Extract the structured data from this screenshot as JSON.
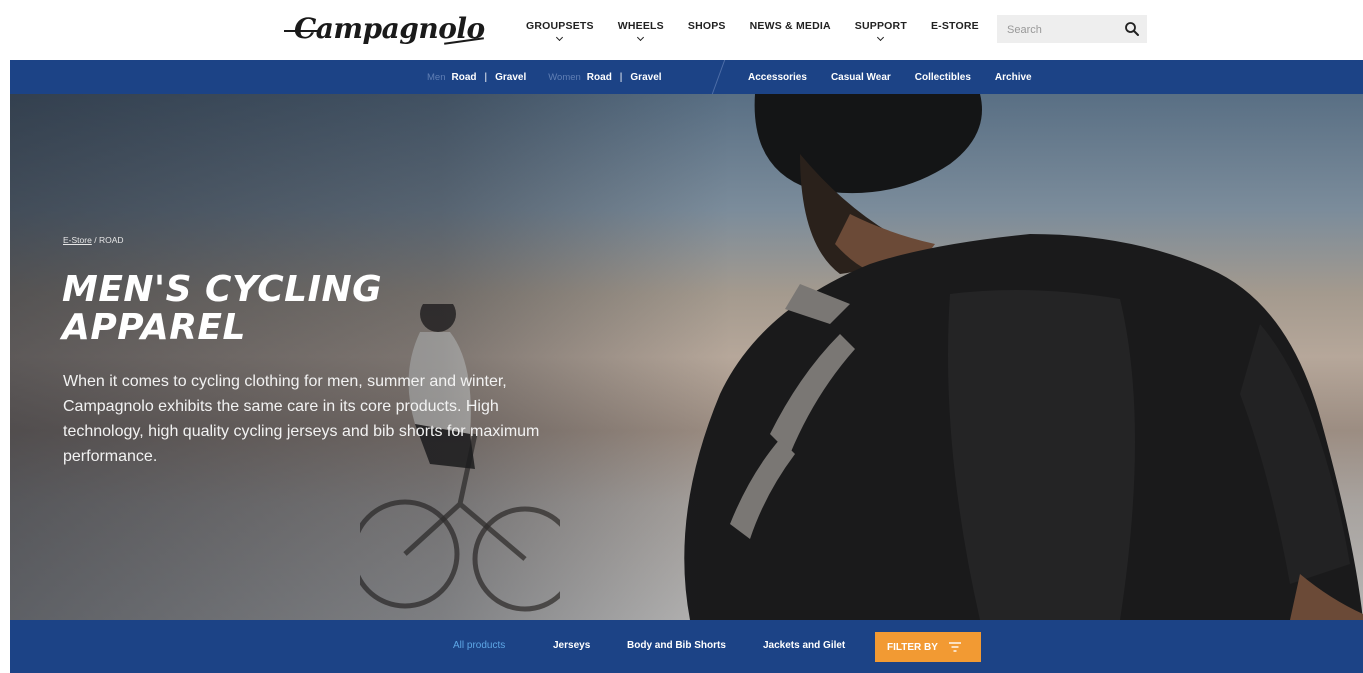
{
  "header": {
    "logo_text": "Campagnolo",
    "nav": [
      {
        "label": "GROUPSETS",
        "dropdown": true
      },
      {
        "label": "WHEELS",
        "dropdown": true
      },
      {
        "label": "SHOPS",
        "dropdown": false
      },
      {
        "label": "NEWS & MEDIA",
        "dropdown": false
      },
      {
        "label": "SUPPORT",
        "dropdown": true
      },
      {
        "label": "E-STORE",
        "dropdown": false
      }
    ],
    "search_placeholder": "Search",
    "search_icon": "search-icon"
  },
  "subnav": {
    "men_label": "Men",
    "men_links": [
      "Road",
      "Gravel"
    ],
    "women_label": "Women",
    "women_links": [
      "Road",
      "Gravel"
    ],
    "separator": "|",
    "right_links": [
      "Accessories",
      "Casual Wear",
      "Collectibles",
      "Archive"
    ]
  },
  "hero": {
    "breadcrumb_link": "E-Store",
    "breadcrumb_sep": "/",
    "breadcrumb_current": "ROAD",
    "title": "MEN'S CYCLING APPAREL",
    "description": "When it comes to cycling clothing for men, summer and winter, Campagnolo exhibits the same care in its core products. High technology, high quality cycling jerseys and bib shorts for maximum performance."
  },
  "filters": {
    "tabs": [
      "All products",
      "Jerseys",
      "Body and Bib Shorts",
      "Jackets and Gilet"
    ],
    "active_index": 0,
    "filter_button": "FILTER BY"
  },
  "colors": {
    "brand_blue": "#1c4386",
    "accent_orange": "#f29a33",
    "active_tab": "#5ea7e6"
  }
}
